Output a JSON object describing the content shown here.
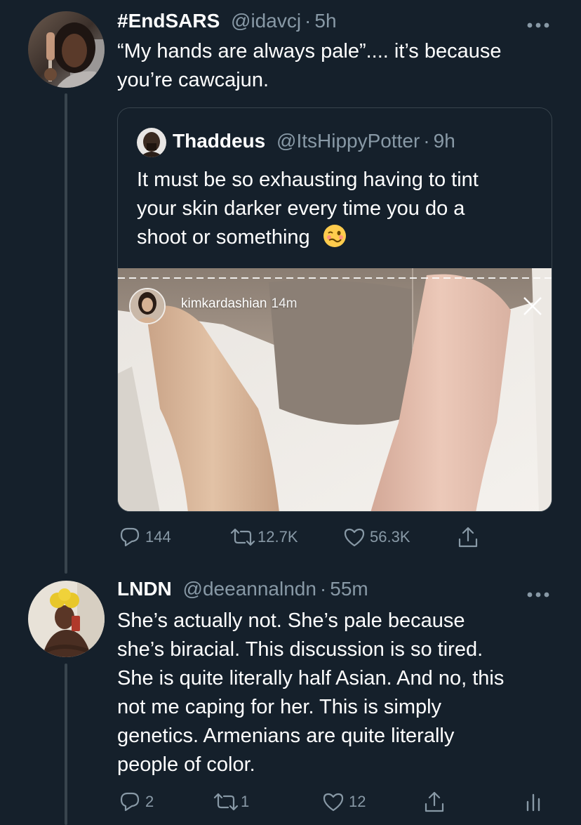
{
  "tweet1": {
    "display_name": "#EndSARS",
    "handle": "@idavcj",
    "separator": "·",
    "time": "5h",
    "text_lines": [
      "“My hands are always pale”.... it’s because",
      "you’re cawcajun."
    ],
    "quote": {
      "display_name": "Thaddeus",
      "handle": "@ItsHippyPotter",
      "separator": "·",
      "time": "9h",
      "text_lines": [
        "It must be so exhausting having to tint",
        "your skin darker every time you do a",
        "shoot or something"
      ],
      "emoji": "woozy-face",
      "story": {
        "username": "kimkardashian",
        "time": "14m"
      }
    },
    "actions": {
      "replies": "144",
      "retweets": "12.7K",
      "likes": "56.3K"
    }
  },
  "tweet2": {
    "display_name": "LNDN",
    "handle": "@deeannalndn",
    "separator": "·",
    "time": "55m",
    "text_lines": [
      "She’s actually not. She’s pale because",
      "she’s biracial. This discussion is so tired.",
      "She is quite literally half Asian. And no, this",
      "not me caping for her. This is simply",
      "genetics. Armenians are quite literally",
      "people of color."
    ],
    "actions": {
      "replies": "2",
      "retweets": "1",
      "likes": "12"
    }
  },
  "colors": {
    "background": "#15202b",
    "text_primary": "#ffffff",
    "text_secondary": "#8899a6",
    "border": "#38444d"
  },
  "icons": [
    "more-icon",
    "reply-icon",
    "retweet-icon",
    "like-icon",
    "share-icon",
    "analytics-icon",
    "close-icon"
  ]
}
